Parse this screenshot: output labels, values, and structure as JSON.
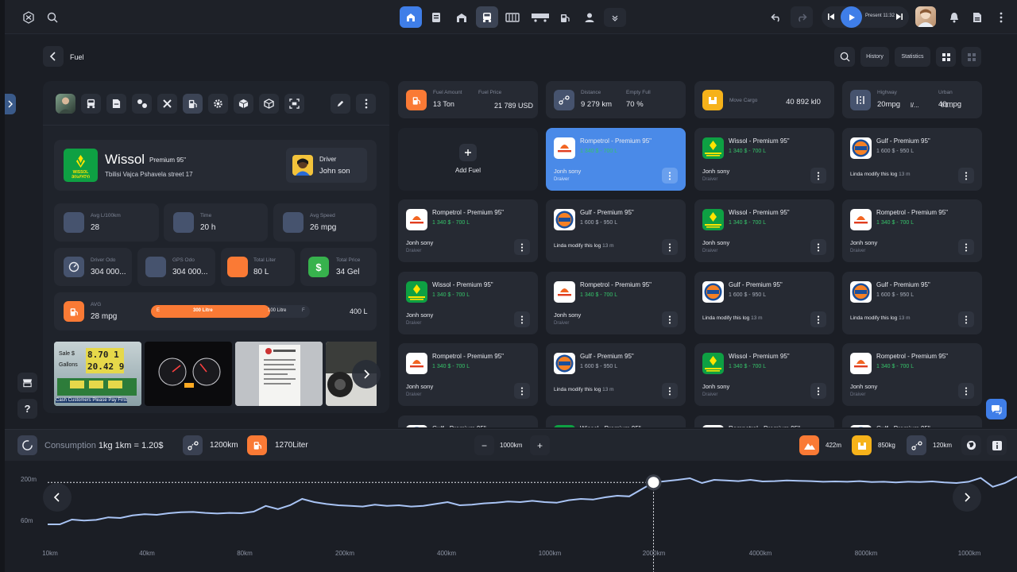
{
  "colors": {
    "accent": "#3f7ee8",
    "orange": "#fa7a35",
    "green": "#37b24d",
    "yellow": "#f6b21a",
    "line": "#a9c4f5"
  },
  "topbar": {
    "present": "Present 11:32"
  },
  "header": {
    "breadcrumb": "Fuel",
    "history": "History",
    "statistics": "Statistics"
  },
  "station": {
    "brand": "Wissol",
    "grade": "Premium 95\"",
    "address": "Tbilisi Vajca Pshavela street 17",
    "logo_text": "WISSOL ᲕᲘᲡᲝᲚᲘ",
    "driver_label": "Driver",
    "driver_name": "John son"
  },
  "metrics": {
    "avg_label": "Avg L/100km",
    "avg_value": "28",
    "time_label": "Time",
    "time_value": "20 h",
    "speed_label": "Avg Speed",
    "speed_value": "26 mpg",
    "driver_odo_label": "Driver Odo",
    "driver_odo_value": "304 000...",
    "gps_odo_label": "GPS Odo",
    "gps_odo_value": "304 000...",
    "total_liter_label": "Total Liter",
    "total_liter_value": "80 L",
    "total_price_label": "Total Price",
    "total_price_value": "34 Gel",
    "avg2_label": "AVG",
    "avg2_value": "28 mpg",
    "gauge_e": "E",
    "gauge_fill_label": "300 Litre",
    "gauge_rest": "100 Litre",
    "gauge_f": "F",
    "gauge_total": "400 L",
    "gauge_fraction": 0.75
  },
  "photos": {
    "gas_price_top": "8.70 1",
    "gas_price_bottom": "20.42 9",
    "gas_sale": "Sale $",
    "gas_gallons": "Gallons",
    "gas_footer": "Cash Customers Please Pay First"
  },
  "stats": {
    "fuel_amount_label": "Fuel Amount",
    "fuel_amount_value": "13 Ton",
    "fuel_price_label": "Fuel Price",
    "fuel_price_value": "21 789 USD",
    "distance_label": "Distance",
    "distance_value": "9 279 km",
    "empty_full_label": "Empty Full",
    "empty_full_value": "70 %",
    "move_cargo_label": "Move Cargo",
    "move_cargo_value": "40 892 kl0",
    "highway_label": "Highway",
    "highway_value": "20mpg",
    "urban_label": "Urban",
    "urban_value": "40mpg",
    "sep": "l/... l/1..."
  },
  "add_fuel": "Add Fuel",
  "tiles": [
    {
      "brand": "Rompetrol - Premium 95\"",
      "price": "1 340 $ - 700 L",
      "person": "Jonh sony",
      "role": "Draiver",
      "kind": "r",
      "hl": true
    },
    {
      "brand": "Wissol - Premium 95\"",
      "price": "1 340 $ - 700 L",
      "person": "Jonh sony",
      "role": "Draiver",
      "kind": "w"
    },
    {
      "brand": "Gulf - Premium 95\"",
      "price": "1 600 $ - 950 L",
      "mod": "Linda modify this log",
      "time": "13 m",
      "kind": "g"
    },
    {
      "brand": "Rompetrol - Premium 95\"",
      "price": "1 340 $ - 700 L",
      "person": "Jonh sony",
      "role": "Draiver",
      "kind": "r"
    },
    {
      "brand": "Gulf - Premium 95\"",
      "price": "1 600 $ - 950 L",
      "mod": "Linda modify this log",
      "time": "13 m",
      "kind": "g"
    },
    {
      "brand": "Wissol - Premium 95\"",
      "price": "1 340 $ - 700 L",
      "person": "Jonh sony",
      "role": "Draiver",
      "kind": "w"
    },
    {
      "brand": "Rompetrol - Premium 95\"",
      "price": "1 340 $ - 700 L",
      "person": "Jonh sony",
      "role": "Draiver",
      "kind": "r"
    },
    {
      "brand": "Wissol - Premium 95\"",
      "price": "1 340 $ - 700 L",
      "person": "Jonh sony",
      "role": "Draiver",
      "kind": "w"
    },
    {
      "brand": "Rompetrol - Premium 95\"",
      "price": "1 340 $ - 700 L",
      "person": "Jonh sony",
      "role": "Draiver",
      "kind": "r"
    },
    {
      "brand": "Gulf - Premium 95\"",
      "price": "1 600 $ - 950 L",
      "mod": "Linda modify this log",
      "time": "13 m",
      "kind": "g"
    },
    {
      "brand": "Gulf - Premium 95\"",
      "price": "1 600 $ - 950 L",
      "mod": "Linda modify this log",
      "time": "13 m",
      "kind": "g"
    },
    {
      "brand": "Rompetrol - Premium 95\"",
      "price": "1 340 $ - 700 L",
      "person": "Jonh sony",
      "role": "Draiver",
      "kind": "r"
    },
    {
      "brand": "Gulf - Premium 95\"",
      "price": "1 600 $ - 950 L",
      "mod": "Linda modify this log",
      "time": "13 m",
      "kind": "g"
    },
    {
      "brand": "Wissol - Premium 95\"",
      "price": "1 340 $ - 700 L",
      "person": "Jonh sony",
      "role": "Draiver",
      "kind": "w"
    },
    {
      "brand": "Rompetrol - Premium 95\"",
      "price": "1 340 $ - 700 L",
      "person": "Jonh sony",
      "role": "Draiver",
      "kind": "r"
    },
    {
      "brand": "Gulf - Premium 95\"",
      "price": "",
      "kind": "g"
    },
    {
      "brand": "Wissol - Premium 95\"",
      "price": "",
      "kind": "w"
    },
    {
      "brand": "Rompetrol - Premium 95\"",
      "price": "",
      "kind": "r"
    },
    {
      "brand": "Gulf - Premium 95\"",
      "price": "",
      "kind": "g"
    }
  ],
  "consumption": {
    "label": "Consumption",
    "value": "1kg 1km = 1.20$",
    "distance": "1200km",
    "liters": "1270Liter",
    "zoom": "1000km",
    "elev": "422m",
    "weight": "850kg",
    "dist2": "120km"
  },
  "chart_data": {
    "type": "line",
    "y_ticks": [
      "200m",
      "60m"
    ],
    "x_ticks": [
      "10km",
      "40km",
      "80km",
      "200km",
      "400km",
      "1000km",
      "2000km",
      "4000km",
      "8000km",
      "1000km"
    ],
    "marker_index": 50,
    "values": [
      60,
      60,
      75,
      72,
      74,
      82,
      80,
      88,
      92,
      90,
      95,
      98,
      99,
      96,
      94,
      96,
      95,
      100,
      118,
      108,
      120,
      140,
      130,
      124,
      120,
      118,
      116,
      122,
      118,
      120,
      116,
      118,
      124,
      130,
      120,
      122,
      126,
      128,
      132,
      130,
      134,
      130,
      128,
      136,
      140,
      138,
      145,
      150,
      148,
      170,
      192,
      196,
      200,
      205,
      190,
      200,
      198,
      196,
      200,
      195,
      196,
      198,
      197,
      196,
      194,
      195,
      194,
      196,
      193,
      194,
      192,
      194,
      193,
      195,
      192,
      190,
      194,
      206,
      178,
      190,
      210
    ]
  }
}
